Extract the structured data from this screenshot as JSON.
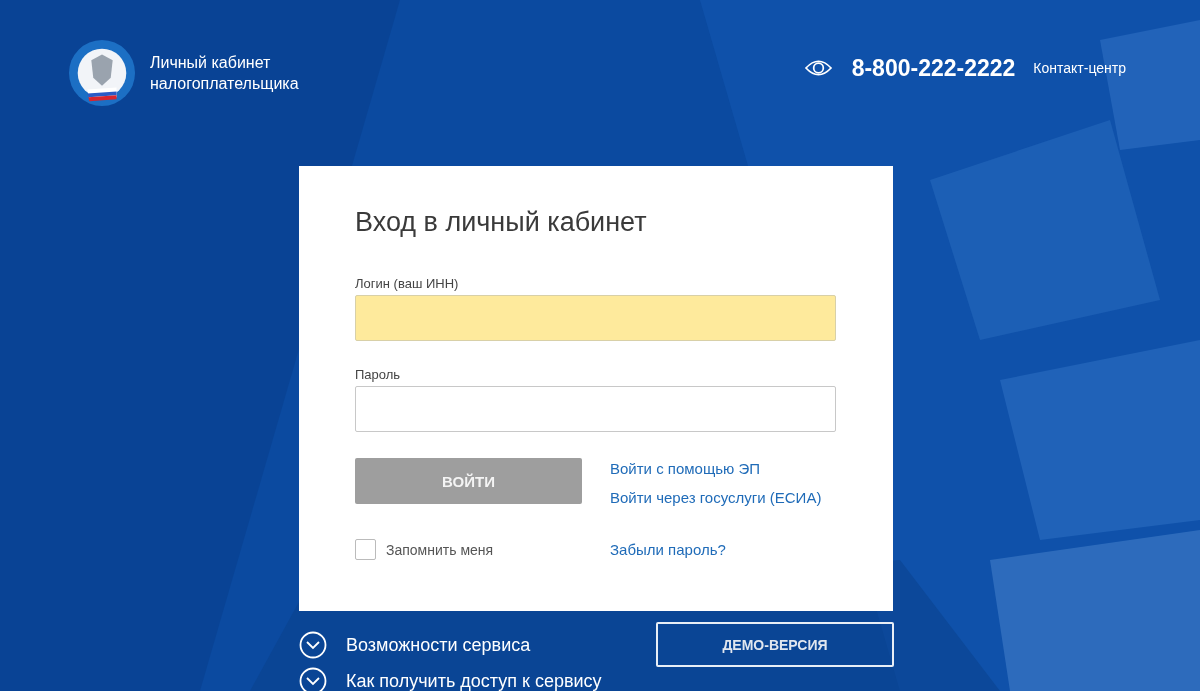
{
  "header": {
    "title_line1": "Личный кабинет",
    "title_line2": "налогоплательщика",
    "phone": "8-800-222-2222",
    "contact_link": "Контакт-центр"
  },
  "login_card": {
    "title": "Вход в личный кабинет",
    "fields": [
      {
        "label": "Логин (ваш ИНН)",
        "autofilled": true
      },
      {
        "label": "Пароль",
        "autofilled": false
      }
    ],
    "submit_button": "ВОЙТИ",
    "submit_disabled": true,
    "alt_links": [
      "Войти с помощью ЭП",
      "Войти через госуслуги (ЕСИА)"
    ],
    "remember": {
      "label": "Запомнить меня",
      "checked": false
    },
    "forgot_link": "Забыли пароль?"
  },
  "sections": [
    {
      "label": "Возможности сервиса",
      "expanded": false
    },
    {
      "label": "Как получить доступ к сервису",
      "expanded": false
    }
  ],
  "demo_button": "ДЕМО-ВЕРСИЯ"
}
